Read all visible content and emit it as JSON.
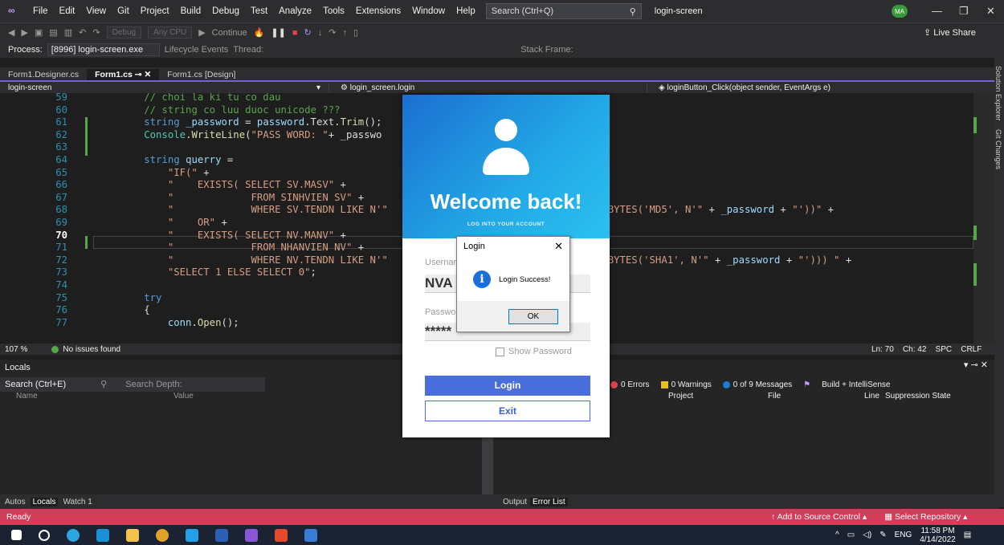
{
  "menubar": {
    "items": [
      "File",
      "Edit",
      "View",
      "Git",
      "Project",
      "Build",
      "Debug",
      "Test",
      "Analyze",
      "Tools",
      "Extensions",
      "Window",
      "Help"
    ],
    "search_placeholder": "Search (Ctrl+Q)",
    "project_name": "login-screen",
    "avatar": "MA"
  },
  "toolbar": {
    "config": "Debug",
    "platform": "Any CPU",
    "continue_label": "Continue",
    "live_share": "Live Share"
  },
  "processbar": {
    "process_label": "Process:",
    "process_value": "[8996] login-screen.exe",
    "lifecycle": "Lifecycle Events",
    "thread": "Thread:",
    "stack_frame": "Stack Frame:"
  },
  "tabs": [
    {
      "label": "Form1.Designer.cs",
      "active": false
    },
    {
      "label": "Form1.cs",
      "active": true
    },
    {
      "label": "Form1.cs [Design]",
      "active": false
    }
  ],
  "navbar": {
    "project": "login-screen",
    "class": "login_screen.login",
    "member": "loginButton_Click(object sender, EventArgs e)"
  },
  "side_panels": [
    "Solution Explorer",
    "Git Changes"
  ],
  "code_lines": [
    {
      "n": "59",
      "parts": [
        [
          "c-com",
          "        // choi la ki tu co dau"
        ]
      ]
    },
    {
      "n": "60",
      "parts": [
        [
          "c-com",
          "        // string co luu duoc unicode ???"
        ]
      ]
    },
    {
      "n": "61",
      "parts": [
        [
          "c-kw",
          "        string "
        ],
        [
          "c-var",
          "_password"
        ],
        [
          "c-id",
          " = "
        ],
        [
          "c-var",
          "password"
        ],
        [
          "c-id",
          ".Text."
        ],
        [
          "c-fn",
          "Trim"
        ],
        [
          "c-id",
          "();"
        ]
      ]
    },
    {
      "n": "62",
      "parts": [
        [
          "c-cls",
          "        Console"
        ],
        [
          "c-id",
          "."
        ],
        [
          "c-fn",
          "WriteLine"
        ],
        [
          "c-id",
          "("
        ],
        [
          "c-str",
          "\"PASS WORD: \""
        ],
        [
          "c-id",
          "+ _passwo"
        ]
      ]
    },
    {
      "n": "63",
      "parts": []
    },
    {
      "n": "64",
      "parts": [
        [
          "c-kw",
          "        string "
        ],
        [
          "c-var",
          "querry"
        ],
        [
          "c-id",
          " ="
        ]
      ]
    },
    {
      "n": "65",
      "parts": [
        [
          "c-str",
          "            \"IF(\""
        ],
        [
          "c-id",
          " +"
        ]
      ]
    },
    {
      "n": "66",
      "parts": [
        [
          "c-str",
          "            \"    EXISTS( SELECT SV.MASV\""
        ],
        [
          "c-id",
          " +"
        ]
      ]
    },
    {
      "n": "67",
      "parts": [
        [
          "c-str",
          "            \"             FROM SINHVIEN SV\""
        ],
        [
          "c-id",
          " +"
        ]
      ]
    },
    {
      "n": "68",
      "parts": [
        [
          "c-str",
          "            \"             WHERE SV.TENDN LIKE N'\""
        ],
        [
          "c-id",
          "                                  "
        ],
        [
          "c-str",
          "ASHBYTES('MD5', N'\""
        ],
        [
          "c-id",
          " + "
        ],
        [
          "c-var",
          "_password"
        ],
        [
          "c-id",
          " + "
        ],
        [
          "c-str",
          "\"'))\""
        ],
        [
          "c-id",
          " +"
        ]
      ]
    },
    {
      "n": "69",
      "parts": [
        [
          "c-str",
          "            \"    OR\""
        ],
        [
          "c-id",
          " +"
        ]
      ]
    },
    {
      "n": "70",
      "parts": [
        [
          "c-str",
          "            \"    EXISTS( SELECT NV.MANV\""
        ],
        [
          "c-id",
          " +"
        ]
      ],
      "current": true
    },
    {
      "n": "71",
      "parts": [
        [
          "c-str",
          "            \"             FROM NHANVIEN NV\""
        ],
        [
          "c-id",
          " +"
        ]
      ]
    },
    {
      "n": "72",
      "parts": [
        [
          "c-str",
          "            \"             WHERE NV.TENDN LIKE N'\""
        ],
        [
          "c-id",
          "                                  "
        ],
        [
          "c-str",
          "ASHBYTES('SHA1', N'\""
        ],
        [
          "c-id",
          " + "
        ],
        [
          "c-var",
          "_password"
        ],
        [
          "c-id",
          " + "
        ],
        [
          "c-str",
          "\"'))) \""
        ],
        [
          "c-id",
          " +"
        ]
      ]
    },
    {
      "n": "73",
      "parts": [
        [
          "c-str",
          "            \"SELECT 1 ELSE SELECT 0\""
        ],
        [
          "c-id",
          ";"
        ]
      ]
    },
    {
      "n": "74",
      "parts": []
    },
    {
      "n": "75",
      "parts": [
        [
          "c-kw",
          "        try"
        ]
      ]
    },
    {
      "n": "76",
      "parts": [
        [
          "c-id",
          "        {"
        ]
      ]
    },
    {
      "n": "77",
      "parts": [
        [
          "c-var",
          "            conn"
        ],
        [
          "c-id",
          "."
        ],
        [
          "c-fn",
          "Open"
        ],
        [
          "c-id",
          "();"
        ]
      ]
    }
  ],
  "editor_status": {
    "zoom": "107 %",
    "issues": "No issues found",
    "ln": "Ln: 70",
    "ch": "Ch: 42",
    "spc": "SPC",
    "crlf": "CRLF"
  },
  "locals": {
    "title": "Locals",
    "search": "Search (Ctrl+E)",
    "search_depth": "Search Depth:",
    "col_name": "Name",
    "col_value": "Value",
    "tabs": [
      "Autos",
      "Locals",
      "Watch 1"
    ]
  },
  "errorlist": {
    "errors": "0 Errors",
    "warnings": "0 Warnings",
    "messages": "0 of 9 Messages",
    "build": "Build + IntelliSense",
    "cols": [
      "Project",
      "File",
      "Line",
      "Suppression State"
    ],
    "tabs": [
      "Output",
      "Error List"
    ]
  },
  "statusbar": {
    "ready": "Ready",
    "source_control": "Add to Source Control",
    "repo": "Select Repository"
  },
  "taskbar": {
    "lang": "ENG",
    "time": "11:58 PM",
    "date": "4/14/2022"
  },
  "login_form": {
    "welcome": "Welcome back!",
    "subtitle": "LOG INTO YOUR ACCOUNT",
    "username_label": "Usernar",
    "username_value": "NVA",
    "password_label": "Passwo",
    "password_value": "*****",
    "show_password": "Show Password",
    "login_btn": "Login",
    "exit_btn": "Exit"
  },
  "msgbox": {
    "title": "Login",
    "text": "Login Success!",
    "ok": "OK"
  },
  "colors": {
    "accent": "#7160e8",
    "status_bar": "#d43c59",
    "login_button": "#4a6fdc"
  }
}
